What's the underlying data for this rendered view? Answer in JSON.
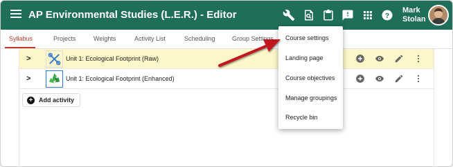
{
  "header": {
    "title": "AP Environmental Studies (L.E.R.) - Editor",
    "user_first": "Mark",
    "user_last": "Stolan",
    "bg_color": "#1e6e5a",
    "icons": [
      "menu-icon",
      "wrench-icon",
      "preview-icon",
      "clipboard-icon",
      "feedback-icon",
      "apps-grid-icon",
      "help-icon"
    ]
  },
  "tabs": [
    {
      "label": "Syllabus",
      "active": true
    },
    {
      "label": "Projects"
    },
    {
      "label": "Weights"
    },
    {
      "label": "Activity List"
    },
    {
      "label": "Scheduling"
    },
    {
      "label": "Group Settings"
    }
  ],
  "rows": [
    {
      "title": "Unit 1: Ecological Footprint (Raw)",
      "highlighted": true,
      "thumb_icon": "tools-icon"
    },
    {
      "title": "Unit 1: Ecological Footprint (Enhanced)",
      "highlighted": false,
      "thumb_icon": "recycle-icon"
    }
  ],
  "row_actions": [
    "add-circle-icon",
    "visibility-icon",
    "edit-pencil-icon",
    "more-vert-icon"
  ],
  "add_activity_label": "Add activity",
  "dropdown": {
    "items": [
      "Course settings",
      "Landing page",
      "Course objectives",
      "Manage groupings",
      "Recycle bin"
    ]
  },
  "annotation": {
    "arrow_color": "#c0181e"
  }
}
